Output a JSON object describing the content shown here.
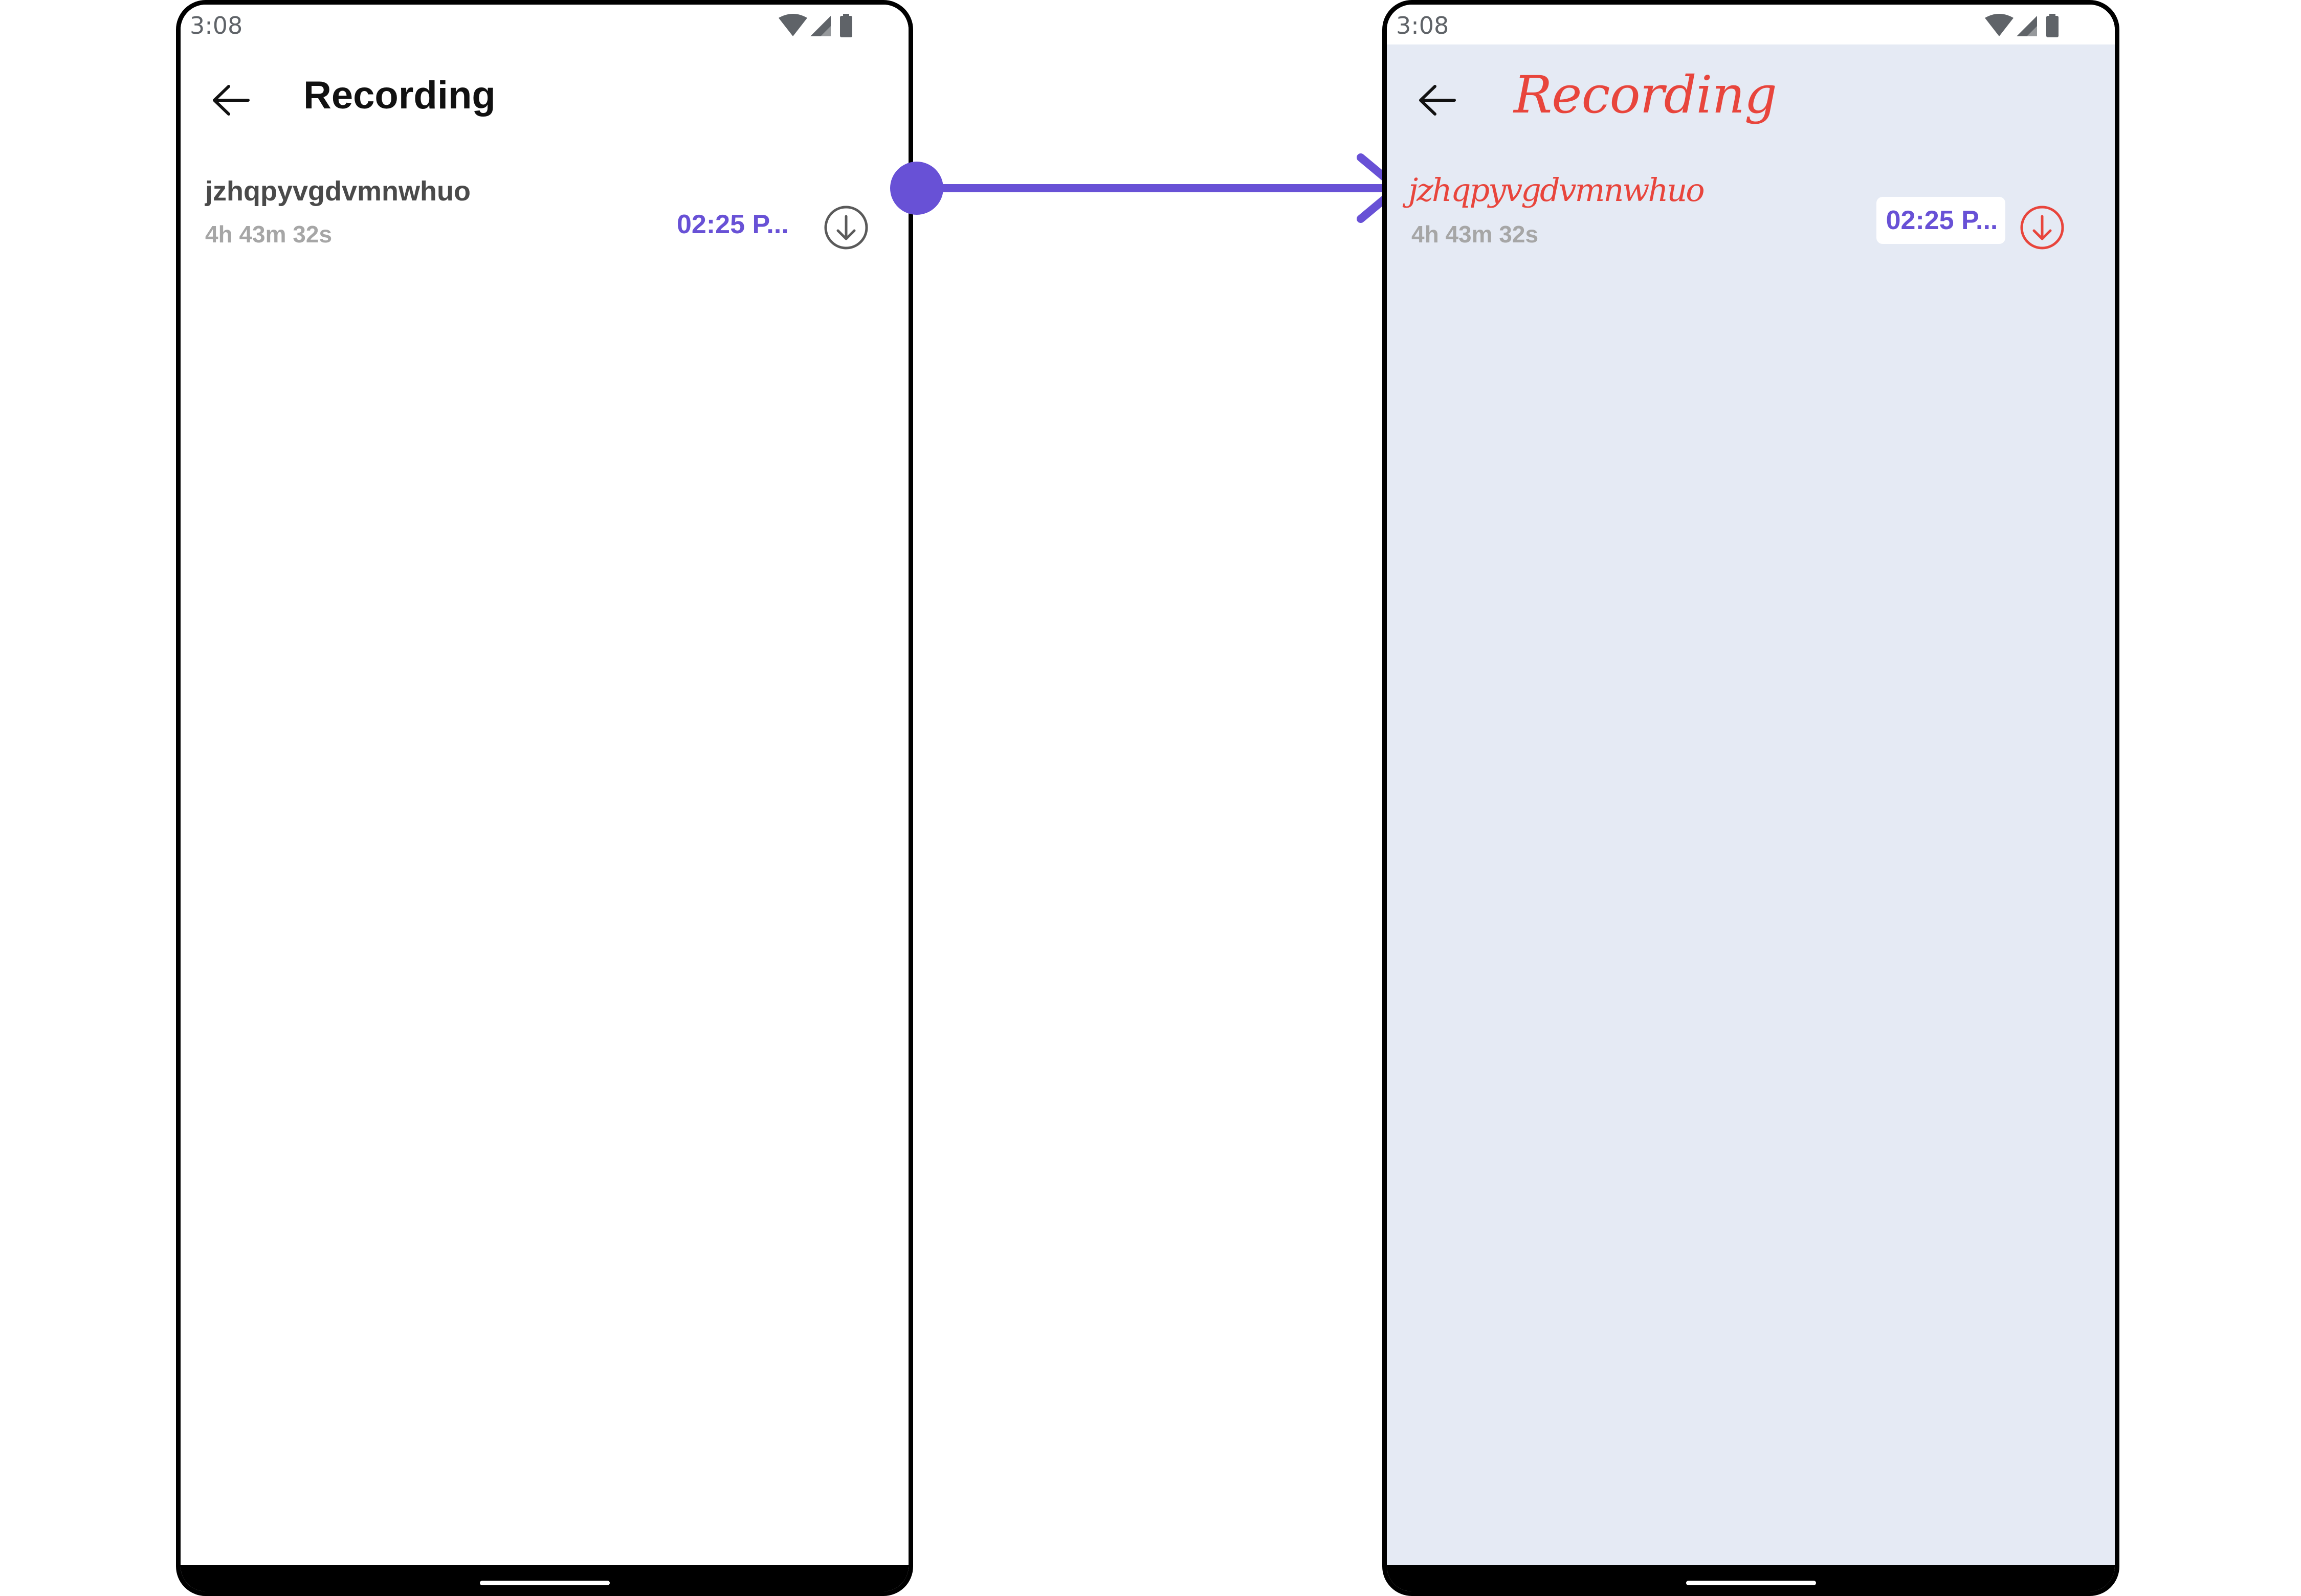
{
  "colors": {
    "accent": "#6851d6",
    "custom_red": "#e8453c",
    "custom_background": "#e5eaf4",
    "default_text": "#111111",
    "subtle_text": "#a6a6a6"
  },
  "default_screen": {
    "status_bar": {
      "time": "3:08",
      "icons": [
        "wifi-icon",
        "signal-icon",
        "battery-icon"
      ]
    },
    "header": {
      "back_icon": "arrow-left-icon",
      "title": "Recording"
    },
    "recording": {
      "name": "jzhqpyvgdvmnwhuo",
      "duration": "4h 43m 32s",
      "time": "02:25 P...",
      "download_icon": "download-circle-icon"
    }
  },
  "customized_screen": {
    "status_bar": {
      "time": "3:08",
      "icons": [
        "wifi-icon",
        "signal-icon",
        "battery-icon"
      ]
    },
    "header": {
      "back_icon": "arrow-left-icon",
      "title": "Recording"
    },
    "recording": {
      "name": "jzhqpyvgdvmnwhuo",
      "duration": "4h 43m 32s",
      "time": "02:25 P...",
      "download_icon": "download-circle-icon"
    }
  },
  "connector": {
    "icon": "arrow-right-icon"
  }
}
